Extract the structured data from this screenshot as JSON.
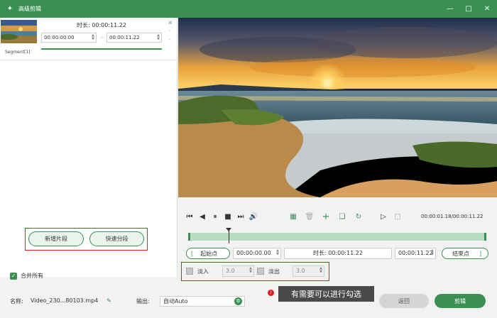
{
  "window": {
    "title": "高级剪辑"
  },
  "segment": {
    "duration_label": "时长:",
    "duration": "00:00:11.22",
    "start": "00:00:00.00",
    "end": "00:00:11.22",
    "name": "Segment[1]",
    "progress": 1.0
  },
  "left_buttons": {
    "add_segment": "新增片段",
    "quick_split": "快速分段"
  },
  "merge": {
    "label": "合并所有",
    "checked": true
  },
  "player": {
    "timecode": "00:00:01.18/00:00:11.22",
    "playhead_fraction": 0.13
  },
  "range": {
    "start_btn": "起始点",
    "start_value": "00:00:00.00",
    "duration_label": "时长:",
    "duration_value": "00:00:11.22",
    "end_value": "00:00:11.22",
    "end_btn": "结束点"
  },
  "fade": {
    "fade_in_label": "淡入",
    "fade_in_value": "3.0",
    "fade_out_label": "淡出",
    "fade_out_value": "3.0"
  },
  "bottom": {
    "name_label": "名称:",
    "file_name": "Video_230...80103.mp4",
    "output_label": "输出:",
    "output_value": "自动Auto",
    "tooltip": "有需要可以进行勾选",
    "back_label": "返回",
    "cut_label": "剪辑"
  },
  "colors": {
    "accent": "#3a8f52",
    "highlight": "#e02020"
  }
}
